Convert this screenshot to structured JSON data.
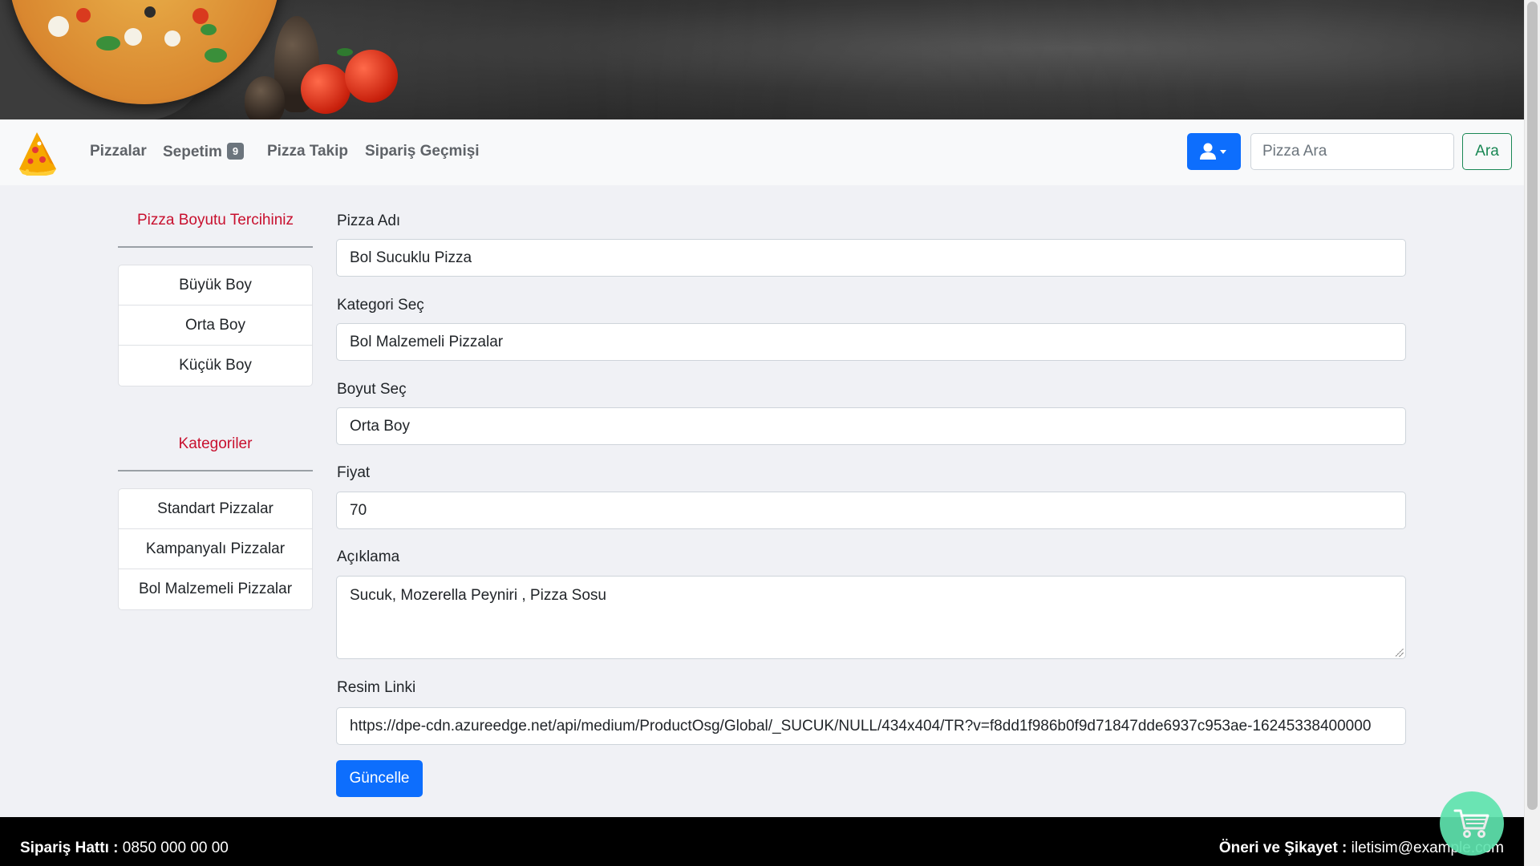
{
  "nav": {
    "links": [
      "Pizzalar",
      "Sepetim",
      "Pizza Takip",
      "Sipariş Geçmişi"
    ],
    "cart_count": "9",
    "search_placeholder": "Pizza Ara",
    "search_button": "Ara",
    "icons": [
      "pizza-slice-logo",
      "user-icon",
      "caret-down-icon"
    ]
  },
  "sidebar": {
    "size_heading": "Pizza Boyutu Tercihiniz",
    "sizes": [
      "Büyük Boy",
      "Orta Boy",
      "Küçük Boy"
    ],
    "category_heading": "Kategoriler",
    "categories": [
      "Standart Pizzalar",
      "Kampanyalı Pizzalar",
      "Bol Malzemeli Pizzalar"
    ]
  },
  "form": {
    "name_label": "Pizza Adı",
    "name_value": "Bol Sucuklu Pizza",
    "category_label": "Kategori Seç",
    "category_value": "Bol Malzemeli Pizzalar",
    "size_label": "Boyut Seç",
    "size_value": "Orta Boy",
    "price_label": "Fiyat",
    "price_value": "70",
    "description_label": "Açıklama",
    "description_value": "Sucuk, Mozerella Peyniri , Pizza Sosu",
    "image_label": "Resim Linki",
    "image_value": "https://dpe-cdn.azureedge.net/api/medium/ProductOsg/Global/_SUCUK/NULL/434x404/TR?v=f8dd1f986b0f9d71847dde6937c953ae-16245338400000",
    "submit": "Güncelle"
  },
  "footer": {
    "hotline_label": "Sipariş Hattı :",
    "hotline_value": "0850 000 00 00",
    "contact_label": "Öneri ve Şikayet :",
    "contact_value": "iletisim@example.com"
  },
  "colors": {
    "primary": "#0d6efd",
    "success": "#198754",
    "heading_red": "#c8102e",
    "cart_fab": "#5fe3ae"
  }
}
